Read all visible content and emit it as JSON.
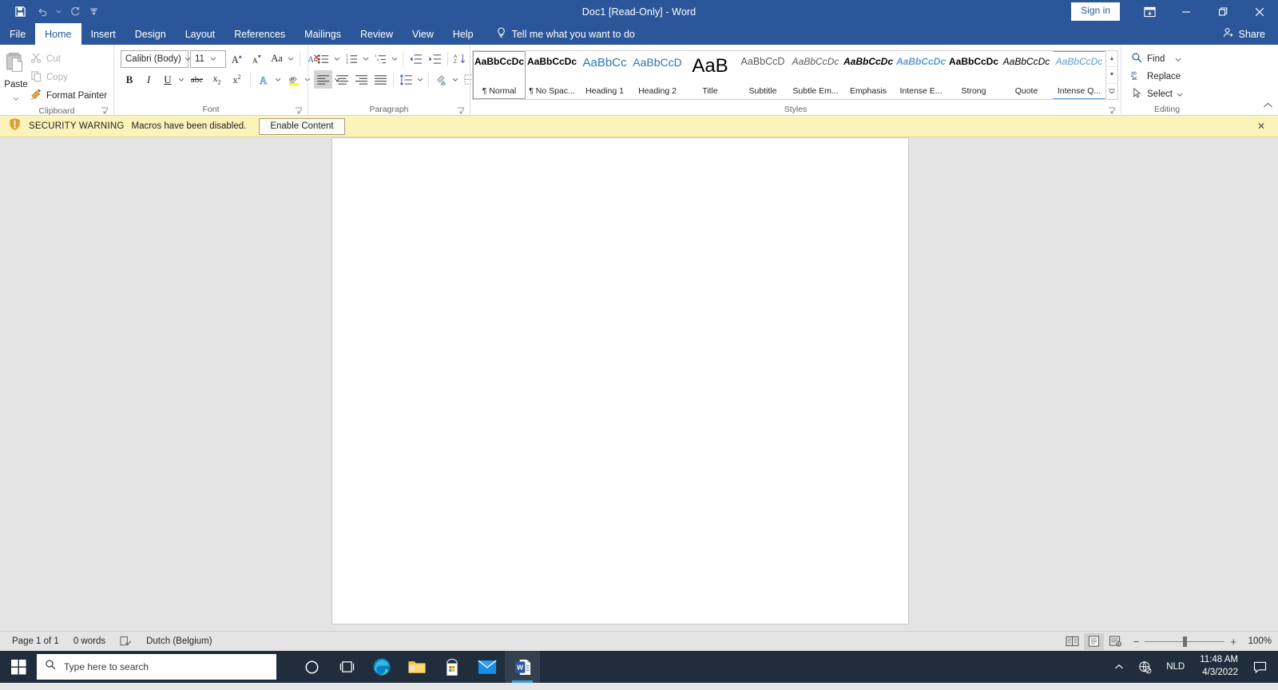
{
  "titlebar": {
    "title": "Doc1 [Read-Only]  -  Word",
    "signin": "Sign in",
    "quick_access": [
      {
        "name": "save-icon",
        "label": "Save"
      },
      {
        "name": "undo-icon",
        "label": "Undo"
      },
      {
        "name": "redo-icon",
        "label": "Redo"
      },
      {
        "name": "customize-qat-icon",
        "label": "Customize Quick Access Toolbar"
      }
    ],
    "window_buttons": [
      {
        "name": "ribbon-display-options-icon",
        "label": "Ribbon Display Options"
      },
      {
        "name": "minimize-icon",
        "label": "Minimize"
      },
      {
        "name": "restore-icon",
        "label": "Restore Down"
      },
      {
        "name": "close-icon",
        "label": "Close"
      }
    ]
  },
  "tabs": [
    {
      "label": "File",
      "active": false
    },
    {
      "label": "Home",
      "active": true
    },
    {
      "label": "Insert",
      "active": false
    },
    {
      "label": "Design",
      "active": false
    },
    {
      "label": "Layout",
      "active": false
    },
    {
      "label": "References",
      "active": false
    },
    {
      "label": "Mailings",
      "active": false
    },
    {
      "label": "Review",
      "active": false
    },
    {
      "label": "View",
      "active": false
    },
    {
      "label": "Help",
      "active": false
    }
  ],
  "tellme": {
    "label": "Tell me what you want to do"
  },
  "share": {
    "label": "Share"
  },
  "ribbon": {
    "clipboard": {
      "group_label": "Clipboard",
      "paste_label": "Paste",
      "commands": [
        {
          "label": "Cut",
          "icon": "scissors-icon",
          "disabled": true
        },
        {
          "label": "Copy",
          "icon": "copy-icon",
          "disabled": true
        },
        {
          "label": "Format Painter",
          "icon": "format-painter-icon",
          "disabled": false
        }
      ]
    },
    "font": {
      "group_label": "Font",
      "font_name": "Calibri (Body)",
      "font_size": "11",
      "row1": [
        {
          "name": "increase-font-size-button",
          "glyph": "A"
        },
        {
          "name": "decrease-font-size-button",
          "glyph": "A"
        },
        {
          "name": "change-case-button",
          "glyph": "Aa"
        },
        {
          "name": "clear-formatting-button",
          "glyph": "A"
        }
      ],
      "row2": [
        {
          "name": "bold-button",
          "glyph": "B"
        },
        {
          "name": "italic-button",
          "glyph": "I"
        },
        {
          "name": "underline-button",
          "glyph": "U"
        },
        {
          "name": "strikethrough-button",
          "glyph": "abc"
        },
        {
          "name": "subscript-button",
          "glyph": "x"
        },
        {
          "name": "superscript-button",
          "glyph": "x"
        },
        {
          "name": "text-effects-button",
          "glyph": "A"
        },
        {
          "name": "text-highlight-color-button",
          "glyph": "ab"
        },
        {
          "name": "font-color-button",
          "glyph": "A"
        }
      ]
    },
    "paragraph": {
      "group_label": "Paragraph",
      "row1": [
        {
          "name": "bullets-button"
        },
        {
          "name": "numbering-button"
        },
        {
          "name": "multilevel-list-button"
        },
        {
          "name": "decrease-indent-button"
        },
        {
          "name": "increase-indent-button"
        },
        {
          "name": "sort-button"
        },
        {
          "name": "show-formatting-marks-button"
        }
      ],
      "row2": [
        {
          "name": "align-left-button"
        },
        {
          "name": "align-center-button"
        },
        {
          "name": "align-right-button"
        },
        {
          "name": "justify-button"
        },
        {
          "name": "line-spacing-button"
        },
        {
          "name": "shading-button"
        },
        {
          "name": "borders-button"
        }
      ]
    },
    "styles": {
      "group_label": "Styles",
      "items": [
        {
          "preview": "AaBbCcDc",
          "name": "¶ Normal",
          "selected": true,
          "style": "normal"
        },
        {
          "preview": "AaBbCcDc",
          "name": "¶ No Spac...",
          "selected": false,
          "style": "nospacing"
        },
        {
          "preview": "AaBbCс",
          "name": "Heading 1",
          "selected": false,
          "style": "heading1"
        },
        {
          "preview": "AaBbCcD",
          "name": "Heading 2",
          "selected": false,
          "style": "heading2"
        },
        {
          "preview": "AaB",
          "name": "Title",
          "selected": false,
          "style": "title"
        },
        {
          "preview": "AaBbCcD",
          "name": "Subtitle",
          "selected": false,
          "style": "subtitle"
        },
        {
          "preview": "AaBbCcDc",
          "name": "Subtle Em...",
          "selected": false,
          "style": "subtleemph"
        },
        {
          "preview": "AaBbCcDc",
          "name": "Emphasis",
          "selected": false,
          "style": "emphasis"
        },
        {
          "preview": "AaBbCcDc",
          "name": "Intense E...",
          "selected": false,
          "style": "intenseemph"
        },
        {
          "preview": "AaBbCcDc",
          "name": "Strong",
          "selected": false,
          "style": "strong"
        },
        {
          "preview": "AaBbCcDc",
          "name": "Quote",
          "selected": false,
          "style": "quote"
        },
        {
          "preview": "AaBbCcDc",
          "name": "Intense Q...",
          "selected": false,
          "style": "intensequote"
        }
      ],
      "scroll_buttons": [
        {
          "name": "styles-scroll-up-button",
          "glyph": "▲"
        },
        {
          "name": "styles-scroll-down-button",
          "glyph": "▼"
        },
        {
          "name": "styles-more-button",
          "glyph": "▾"
        }
      ]
    },
    "editing": {
      "group_label": "Editing",
      "commands": [
        {
          "label": "Find",
          "icon": "magnifier-icon",
          "has_arrow": true
        },
        {
          "label": "Replace",
          "icon": "replace-icon",
          "has_arrow": false
        },
        {
          "label": "Select",
          "icon": "cursor-icon",
          "has_arrow": true
        }
      ]
    }
  },
  "security_bar": {
    "icon": "warning-shield-icon",
    "title": "SECURITY WARNING",
    "message": "Macros have been disabled.",
    "button": "Enable Content",
    "close": "✕",
    "background": "#fcf3ba"
  },
  "statusbar": {
    "page": "Page 1 of 1",
    "words": "0 words",
    "proofing_icon": "proofing-errors-icon",
    "language": "Dutch (Belgium)",
    "views": [
      {
        "name": "read-mode-button",
        "active": false
      },
      {
        "name": "print-layout-button",
        "active": true
      },
      {
        "name": "web-layout-button",
        "active": false
      }
    ],
    "zoom_out": "−",
    "zoom_in": "+",
    "zoom": "100%"
  },
  "taskbar": {
    "start": "start-icon",
    "search_placeholder": "Type here to search",
    "icons": [
      {
        "name": "cortana-icon"
      },
      {
        "name": "task-view-icon"
      },
      {
        "name": "edge-icon"
      },
      {
        "name": "file-explorer-icon"
      },
      {
        "name": "microsoft-store-icon"
      },
      {
        "name": "mail-icon"
      },
      {
        "name": "word-icon",
        "active": true
      }
    ],
    "tray": {
      "show_hidden": "⌃",
      "network_icon": "network-globe-icon",
      "language": "NLD",
      "time": "11:48 AM",
      "date": "4/3/2022",
      "notifications": "notification-icon"
    }
  },
  "colors": {
    "accent": "#2b579a",
    "warning_bg": "#fcf3ba",
    "workspace": "#e4e4e4",
    "taskbar": "#1f2d3d"
  }
}
